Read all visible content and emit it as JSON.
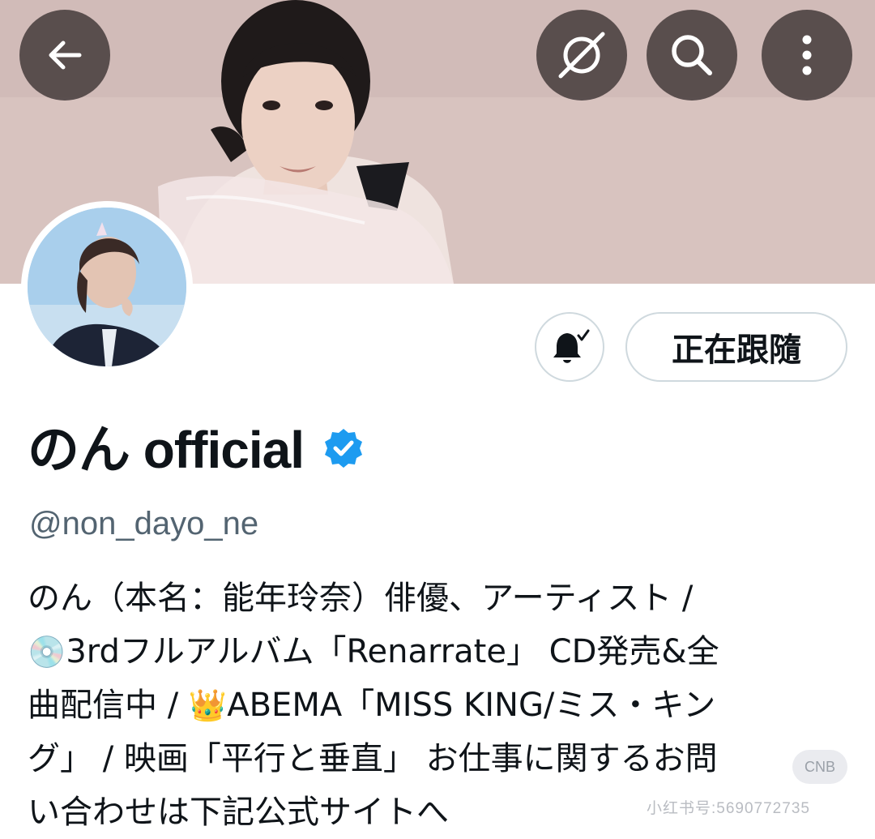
{
  "profile": {
    "display_name": "のん official",
    "handle": "@non_dayo_ne",
    "verified": true,
    "verified_color": "#1d9bf0",
    "bio_lines": [
      "のん（本名：能年玲奈）俳優、アーティスト /",
      "3rdフルアルバム「Renarrate」 CD発売&全",
      "曲配信中 / ",
      "ABEMA「MISS KING/ミス・キン",
      "グ」 / 映画「平行と垂直」 お仕事に関するお問",
      "い合わせは下記公式サイトへ"
    ],
    "bio_emojis": [
      "💿",
      "👑"
    ]
  },
  "actions": {
    "follow_label": "正在跟隨",
    "notification_state": "bell-subscribed"
  },
  "header": {
    "icons": [
      "back-arrow-icon",
      "no-translate-icon",
      "search-icon",
      "more-vertical-icon"
    ]
  },
  "watermark": {
    "text": "小红书号:5690772735",
    "badge": "CNB"
  },
  "colors": {
    "accent": "#1d9bf0",
    "text_primary": "#0f1419",
    "text_secondary": "#536471",
    "border": "#cfd9de"
  }
}
